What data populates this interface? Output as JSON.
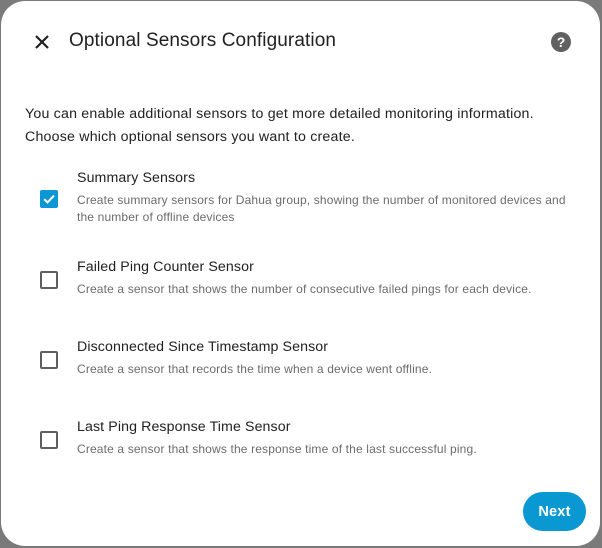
{
  "dialog": {
    "title": "Optional Sensors Configuration",
    "intro_line1": "You can enable additional sensors to get more detailed monitoring information.",
    "intro_line2": "Choose which optional sensors you want to create.",
    "next_label": "Next",
    "accent_color": "#0b96d6",
    "close_icon": "close-icon",
    "help_icon": "help-circle-icon"
  },
  "options": [
    {
      "label": "Summary Sensors",
      "description": "Create summary sensors for Dahua group, showing the number of monitored devices and the number of offline devices",
      "checked": true
    },
    {
      "label": "Failed Ping Counter Sensor",
      "description": "Create a sensor that shows the number of consecutive failed pings for each device.",
      "checked": false
    },
    {
      "label": "Disconnected Since Timestamp Sensor",
      "description": "Create a sensor that records the time when a device went offline.",
      "checked": false
    },
    {
      "label": "Last Ping Response Time Sensor",
      "description": "Create a sensor that shows the response time of the last successful ping.",
      "checked": false
    }
  ]
}
